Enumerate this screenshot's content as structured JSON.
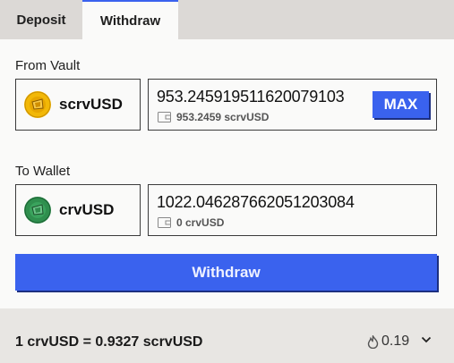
{
  "tabs": [
    {
      "label": "Deposit"
    },
    {
      "label": "Withdraw"
    }
  ],
  "from": {
    "section_label": "From Vault",
    "token": "scrvUSD",
    "token_icon": "scrvusd-token-icon",
    "amount": "953.245919511620079103",
    "balance": "953.2459 scrvUSD",
    "max_label": "MAX"
  },
  "to": {
    "section_label": "To Wallet",
    "token": "crvUSD",
    "token_icon": "crvusd-token-icon",
    "amount": "1022.046287662051203084",
    "balance": "0 crvUSD"
  },
  "action": {
    "label": "Withdraw"
  },
  "footer": {
    "rate": "1 crvUSD = 0.9327 scrvUSD",
    "gas": "0.19"
  },
  "colors": {
    "accent": "#3a62ee",
    "scrvusd_icon": "#f2b807",
    "crvusd_icon": "#2f8f4e"
  }
}
